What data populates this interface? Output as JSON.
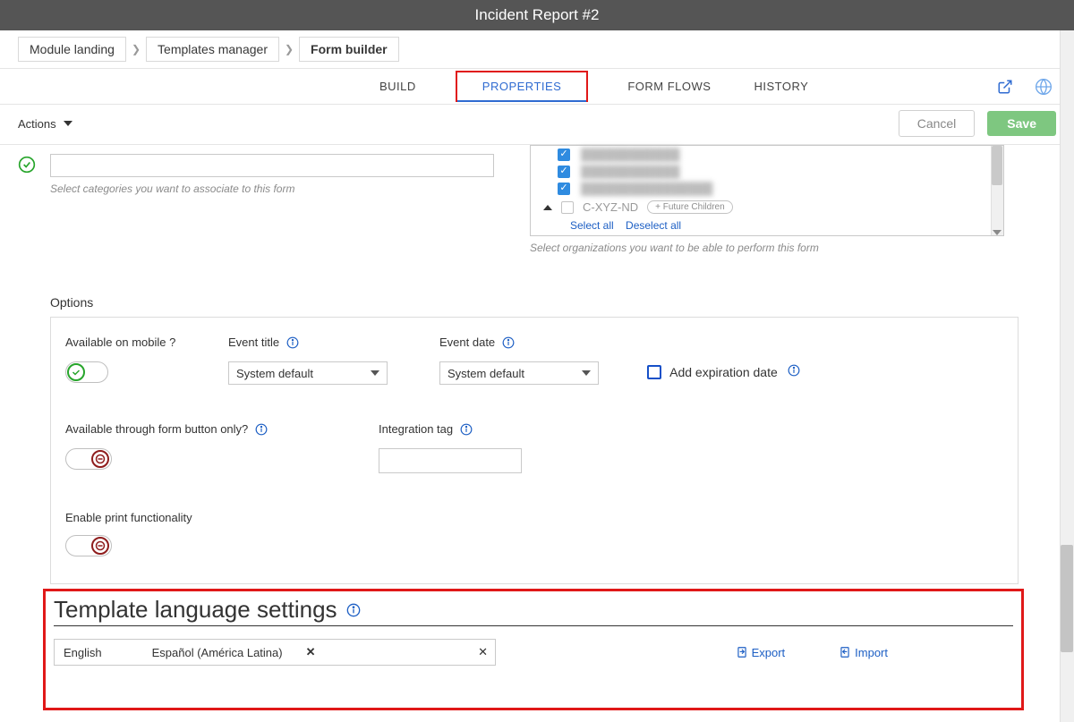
{
  "header": {
    "title": "Incident Report #2"
  },
  "breadcrumbs": [
    {
      "label": "Module landing"
    },
    {
      "label": "Templates manager"
    },
    {
      "label": "Form builder"
    }
  ],
  "tabs": {
    "build": "BUILD",
    "properties": "PROPERTIES",
    "formflows": "FORM FLOWS",
    "history": "HISTORY"
  },
  "actions": {
    "label": "Actions",
    "cancel": "Cancel",
    "save": "Save"
  },
  "categories": {
    "helper": "Select categories you want to associate to this form"
  },
  "orgs": {
    "row4_label": "C-XYZ-ND",
    "future_chip": "+ Future Children",
    "select_all": "Select all",
    "deselect_all": "Deselect all",
    "helper": "Select organizations you want to be able to perform this form"
  },
  "options": {
    "heading": "Options",
    "mobile_label": "Available on mobile ?",
    "event_title_label": "Event title",
    "event_date_label": "Event date",
    "event_title_value": "System default",
    "event_date_value": "System default",
    "expiration_label": "Add expiration date",
    "form_button_only_label": "Available through form button only?",
    "integration_tag_label": "Integration tag",
    "print_label": "Enable print functionality"
  },
  "language": {
    "heading": "Template language settings",
    "lang1": "English",
    "lang2": "Español (América Latina)",
    "export": "Export",
    "import": "Import"
  }
}
